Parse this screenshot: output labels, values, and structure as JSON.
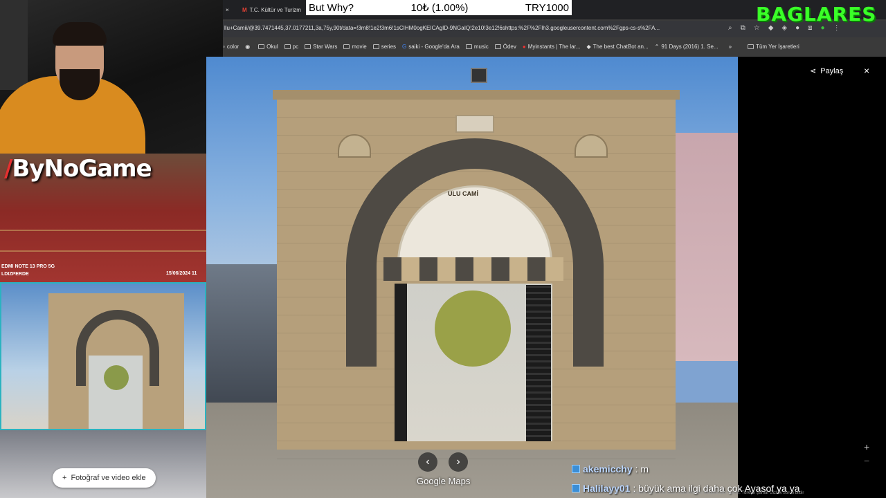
{
  "stream": {
    "donation": {
      "title": "But Why?",
      "amount": "10₺ (1.00%)",
      "goal": "TRY1000"
    },
    "channel_name": "BAGLARES",
    "sponsor_logo": "ByNoGame",
    "camera_caption_left": "EDMI NOTE 13 PRO 5G",
    "camera_caption_left2": "LDIZPERDE",
    "camera_caption_date": "15/06/2024  11"
  },
  "browser": {
    "tabs": [
      {
        "label": "×",
        "icon": "close-icon"
      },
      {
        "label": "T.C. Kültür ve Turizm",
        "icon": "gmail-icon"
      }
    ],
    "url": "llu+Camii/@39.7471445,37.0177211,3a,75y,90t/data=!3m8!1e2!3m6!1sCIHM0ogKEICAgID-9NGaIQ!2e10!3e12!6shttps:%2F%2Flh3.googleusercontent.com%2Fgps-cs-s%2FA...",
    "bookmarks": [
      "color",
      "",
      "Okul",
      "pc",
      "Star Wars",
      "movie",
      "series",
      "saiki - Google'da Ara",
      "music",
      "Ödev",
      "Myinstants | The lar...",
      "The best ChatBot an...",
      "91 Days (2016) 1. Se..."
    ],
    "bookmarks_more": "»",
    "all_bookmarks": "Tüm Yer İşaretleri"
  },
  "maps": {
    "share_label": "Paylaş",
    "close_label": "×",
    "add_photo_label": "Fotoğraf ve video ekle",
    "google_maps_label": "Google Maps",
    "prev_label": "‹",
    "next_label": "›",
    "zoom_in": "+",
    "zoom_out": "−",
    "arch_inscription": "ULU CAMİ",
    "footer": "Görüntünün çekilme tarihi: Kas 2022   Görselleri telif hakkına tabi olabilir.   Türkiye   Şartlar   Gizlilik   Sorun bildir"
  },
  "chat": [
    {
      "user": "akemicchy",
      "message": ": m"
    },
    {
      "user": "Halilayy01",
      "message": ": büyük ama ilgi daha çok Ayasof ya ya"
    }
  ],
  "colors": {
    "accent_green": "#3aff28",
    "chat_badge": "#3b8ed6",
    "thumb_border": "#2bb3c0"
  }
}
